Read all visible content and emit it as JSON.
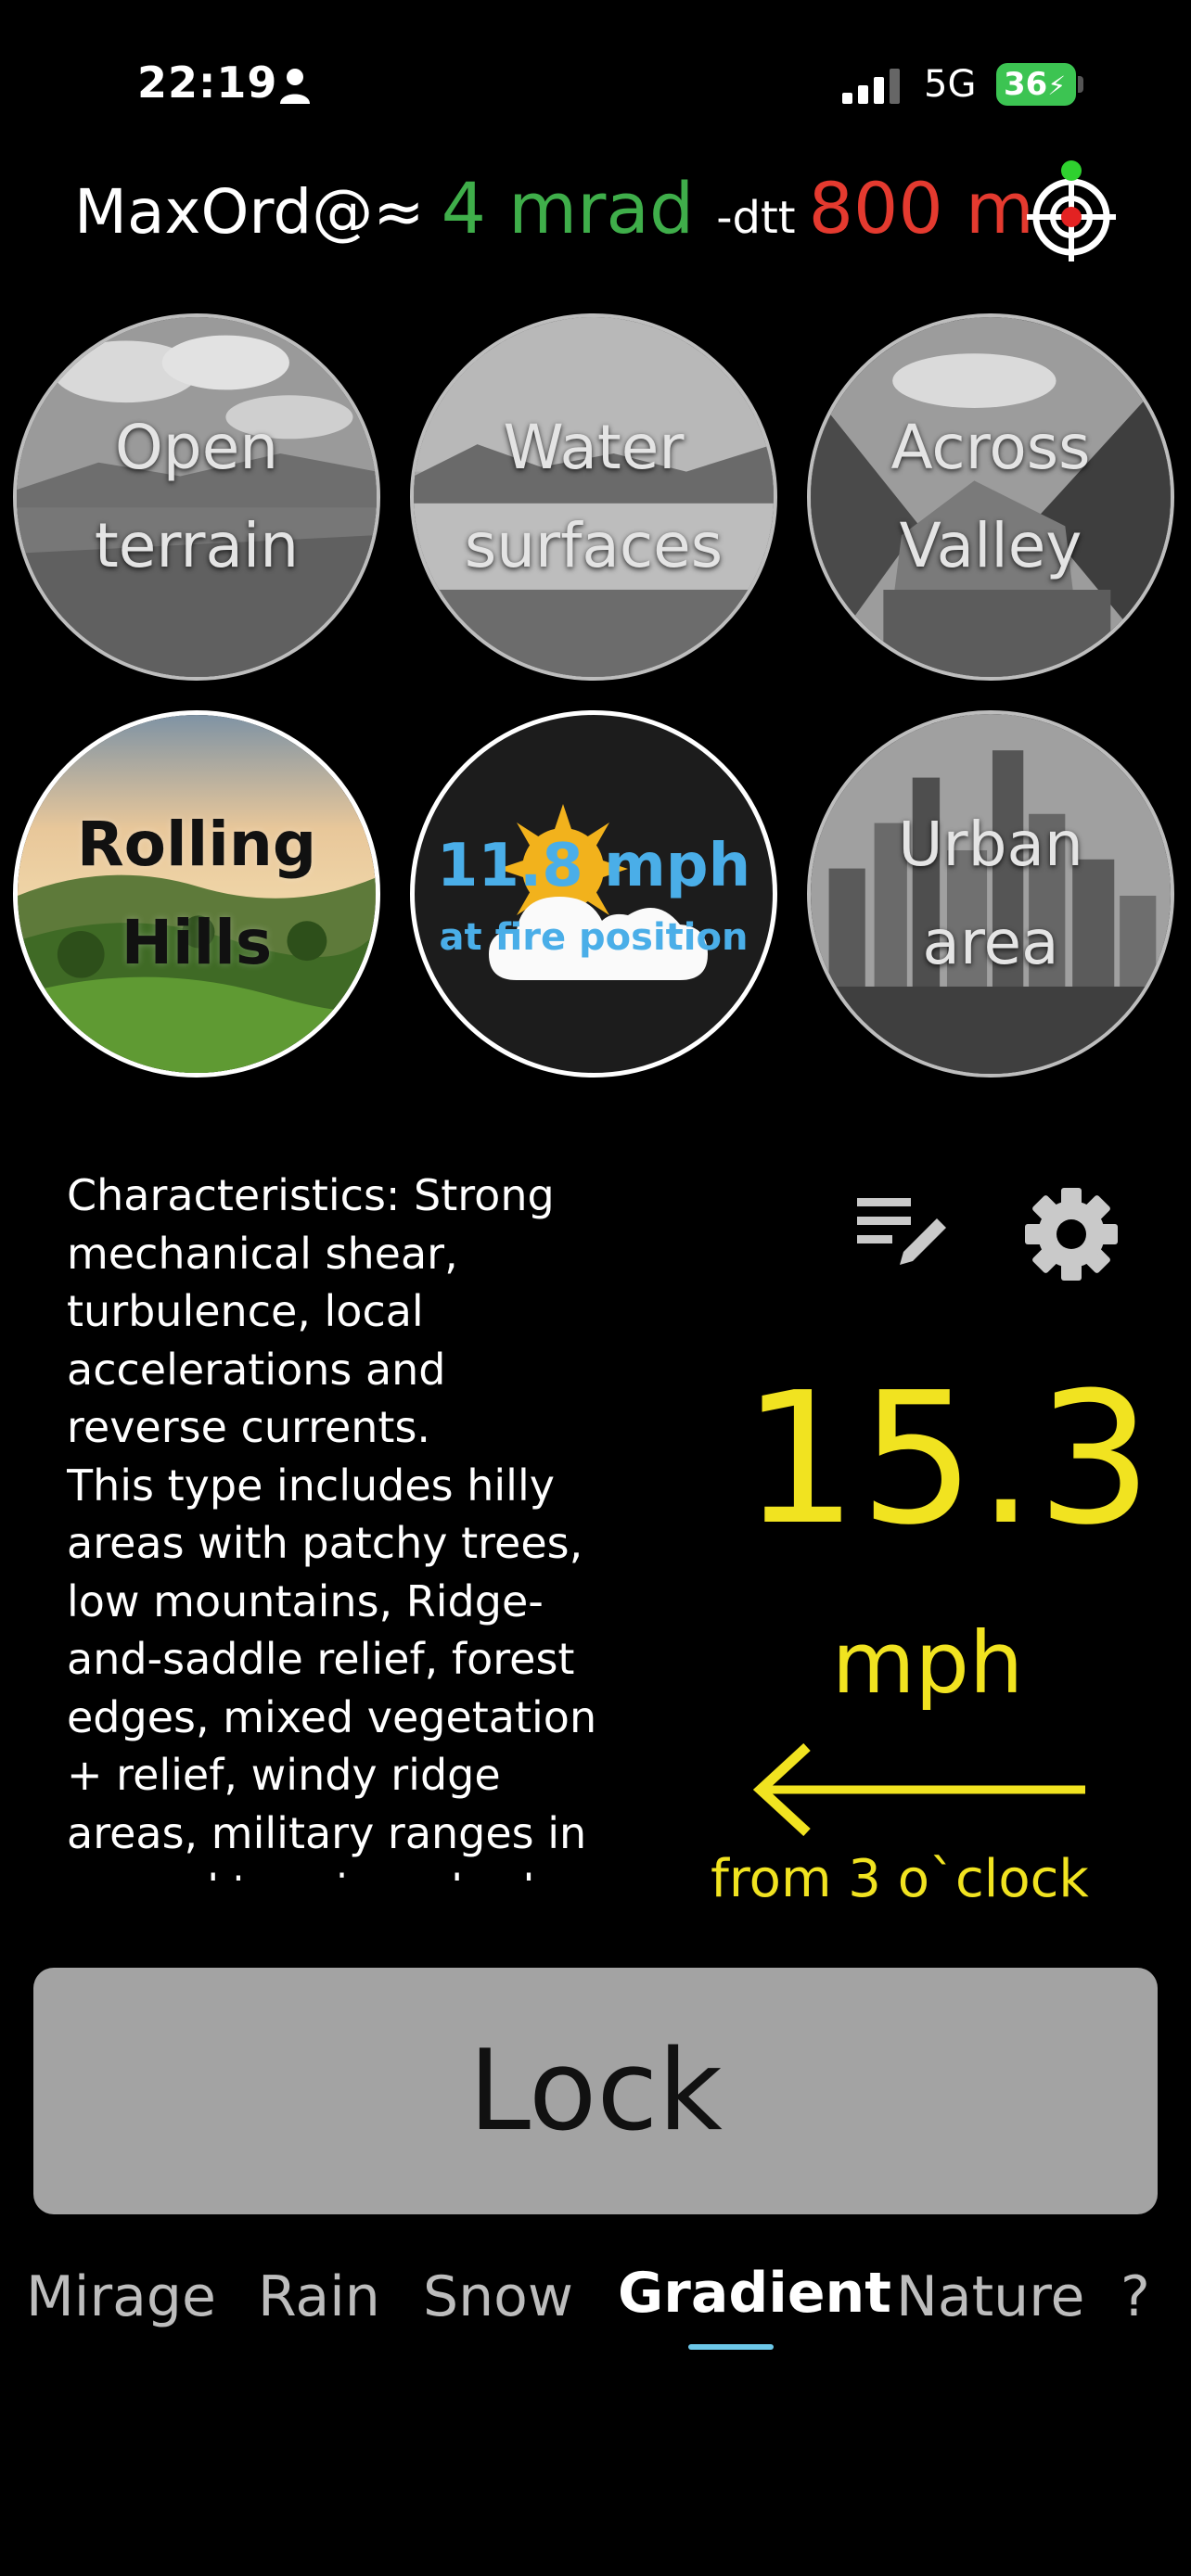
{
  "status_bar": {
    "time": "22:19",
    "network": "5G",
    "battery": "36"
  },
  "header": {
    "label": "MaxOrd@≈",
    "mrad": "4 mrad",
    "dtt": "-dtt",
    "distance": "800 m",
    "colors": {
      "mrad": "#3fae4a",
      "distance": "#e43a2f"
    }
  },
  "tiles": [
    {
      "label_line1": "Open",
      "label_line2": "terrain"
    },
    {
      "label_line1": "Water",
      "label_line2": "surfaces"
    },
    {
      "label_line1": "Across",
      "label_line2": "Valley"
    },
    {
      "label_line1": "Rolling",
      "label_line2": "Hills",
      "selected": true
    },
    {
      "value": "11.8 mph",
      "sub": "at fire position",
      "icon": "partly-cloudy-icon"
    },
    {
      "label_line1": "Urban",
      "label_line2": "area"
    }
  ],
  "description": "Characteristics: Strong mechanical shear, turbulence, local accelerations and reverse currents.\nThis type includes hilly areas with patchy trees, low mountains, Ridge-and-saddle relief, forest edges, mixed vegetation + relief, windy ridge areas, military ranges in rugged terrain, suburbs",
  "wind": {
    "speed": "15.3",
    "unit": "mph",
    "direction": "from 3 o`clock",
    "color": "#f1e320"
  },
  "lock_button": "Lock",
  "tabs": [
    {
      "label": "Mirage"
    },
    {
      "label": "Rain"
    },
    {
      "label": "Snow"
    },
    {
      "label": "Gradient",
      "active": true
    },
    {
      "label": "Nature"
    },
    {
      "label": "?"
    }
  ],
  "icons": [
    "person-icon",
    "signal-icon",
    "target-icon",
    "edit-list-icon",
    "gear-icon",
    "arrow-left-icon"
  ]
}
